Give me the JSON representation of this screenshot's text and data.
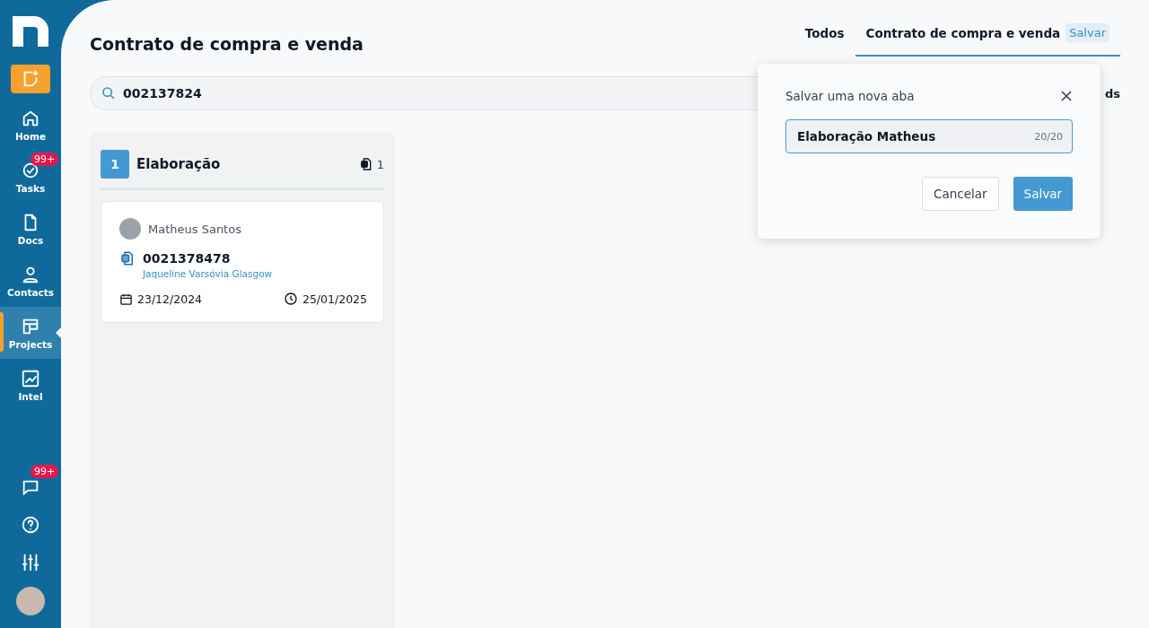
{
  "sidebar": {
    "items": [
      {
        "label": "Home",
        "selected": false
      },
      {
        "label": "Tasks",
        "selected": false,
        "badge": "99+"
      },
      {
        "label": "Docs",
        "selected": false
      },
      {
        "label": "Contacts",
        "selected": false
      },
      {
        "label": "Projects",
        "selected": true
      },
      {
        "label": "Intel",
        "selected": false
      }
    ],
    "bottom": [
      {
        "badge": "99+"
      }
    ]
  },
  "page": {
    "title": "Contrato de compra e venda"
  },
  "tabs": [
    {
      "label": "Todos",
      "selected": false
    },
    {
      "label": "Contrato de compra e venda",
      "selected": true,
      "action": "Salvar"
    }
  ],
  "search": {
    "value": "002137824",
    "trailing": "ds"
  },
  "columns": [
    {
      "number": "1",
      "title": "Elaboração",
      "count": "1",
      "cards": [
        {
          "owner": "Matheus Santos",
          "code": "0021378478",
          "client": "Jaqueline Varsóvia Glasgow",
          "start": "23/12/2024",
          "due": "25/01/2025"
        }
      ]
    }
  ],
  "popup": {
    "title": "Salvar uma nova aba",
    "value": "Elaboração Matheus",
    "counter": "20/20",
    "cancel": "Cancelar",
    "confirm": "Salvar"
  }
}
